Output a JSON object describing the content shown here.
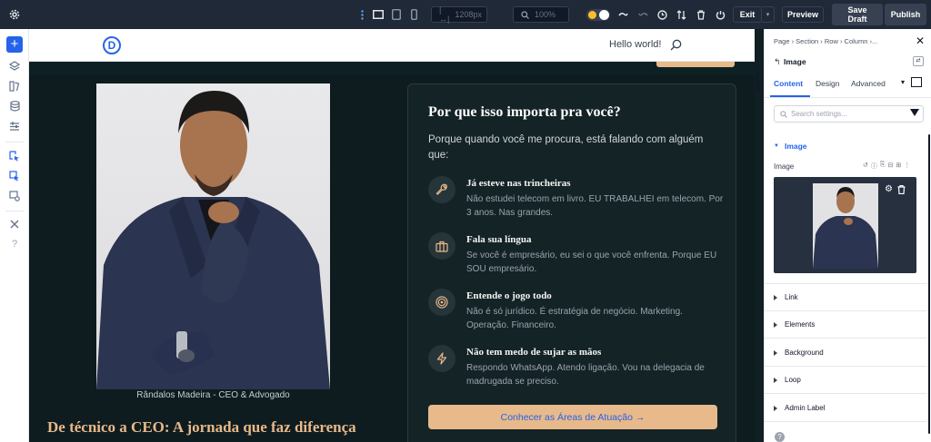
{
  "toolbar": {
    "width_field": "1208px",
    "zoom_field": "100%",
    "exit_label": "Exit",
    "preview_label": "Preview",
    "save_draft_label": "Save Draft",
    "publish_label": "Publish",
    "accent": "#2563eb"
  },
  "site": {
    "logo_letter": "D",
    "nav_link": "Hello world!"
  },
  "hero": {
    "photo_caption": "Rândalos Madeira - CEO & Advogado",
    "section_heading": "De técnico a CEO: A jornada que faz diferença",
    "card": {
      "title": "Por que isso importa pra você?",
      "lead": "Porque quando você me procura, está falando com alguém que:",
      "features": [
        {
          "icon": "wrench-icon",
          "title": "Já esteve nas trincheiras",
          "desc": "Não estudei telecom em livro. EU TRABALHEI em telecom. Por 3 anos. Nas grandes."
        },
        {
          "icon": "briefcase-icon",
          "title": "Fala sua língua",
          "desc": "Se você é empresário, eu sei o que você enfrenta. Porque EU SOU empresário."
        },
        {
          "icon": "target-icon",
          "title": "Entende o jogo todo",
          "desc": "Não é só jurídico. É estratégia de negócio. Marketing. Operação. Financeiro."
        },
        {
          "icon": "lightning-icon",
          "title": "Não tem medo de sujar as mãos",
          "desc": "Respondo WhatsApp. Atendo ligação. Vou na delegacia de madrugada se preciso."
        }
      ],
      "cta": "Conhecer as Áreas de Atuação →",
      "cta_color": "#e8b98a"
    }
  },
  "panel": {
    "breadcrumb": "Page  ›  Section  ›  Row  ›  Column  ›...",
    "element_title": "Image",
    "tabs": [
      "Content",
      "Design",
      "Advanced"
    ],
    "search_placeholder": "Search settings...",
    "group_title": "Image",
    "field_label": "Image",
    "sections": [
      "Link",
      "Elements",
      "Background",
      "Loop",
      "Admin Label"
    ]
  }
}
